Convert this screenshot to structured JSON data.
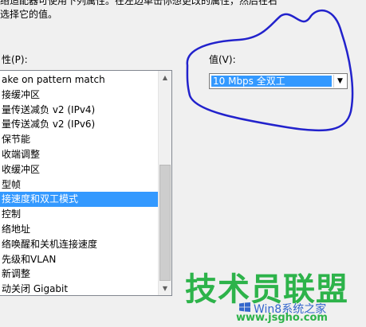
{
  "intro": {
    "line1": "络适配器可使用下列属性。在左边单击你想更改的属性，然后在右",
    "line2": "选择它的值。"
  },
  "properties": {
    "label": "性(P):",
    "items": [
      "ake on pattern match",
      "接缓冲区",
      "量传送减负 v2 (IPv4)",
      "量传送减负 v2 (IPv6)",
      "保节能",
      "收端调整",
      "收缓冲区",
      "型帧",
      "接速度和双工模式",
      "控制",
      "络地址",
      "络唤醒和关机连接速度",
      "先级和VLAN",
      "新调整",
      "动关闭 Gigabit"
    ],
    "selected_index": 8
  },
  "value": {
    "label": "值(V):",
    "selected": "10 Mbps 全双工"
  },
  "watermark": {
    "brand": "技术员联盟",
    "sub": "Win8系统之家",
    "url": "www.jsgho.com"
  },
  "colors": {
    "selection": "#3399ff",
    "annotation": "#2222cc",
    "watermark_green": "#2db34a"
  }
}
